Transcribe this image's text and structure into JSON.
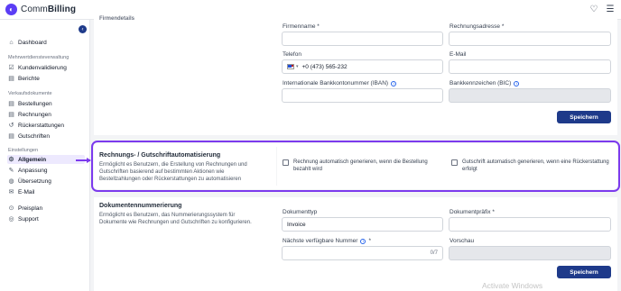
{
  "app": {
    "brand_prefix": "Comm",
    "brand_suffix": "Billing"
  },
  "header": {
    "heart_icon": "heart-icon",
    "menu_icon": "menu-icon"
  },
  "sidebar": {
    "collapse_label": "‹",
    "dashboard": "Dashboard",
    "sec_multi": "Mehrwertdiensteverwaltung",
    "kundenvalidierung": "Kundenvalidierung",
    "berichte": "Berichte",
    "sec_sales": "Verkaufsdokumente",
    "bestellungen": "Bestellungen",
    "rechnungen": "Rechnungen",
    "rueckerstattungen": "Rückerstattungen",
    "gutschriften": "Gutschriften",
    "sec_settings": "Einstellungen",
    "allgemein": "Allgemein",
    "anpassung": "Anpassung",
    "uebersetzung": "Übersetzung",
    "email": "E-Mail",
    "preisplan": "Preisplan",
    "support": "Support"
  },
  "firm": {
    "title": "Firmendetails",
    "firmenname_label": "Firmenname *",
    "rechnungsadresse_label": "Rechnungsadresse *",
    "telefon_label": "Telefon",
    "telefon_value": "+0 (473) 565-232",
    "email_label": "E-Mail",
    "iban_label": "Internationale Bankkontonummer (IBAN)",
    "bic_label": "Bankkennzeichen (BIC)",
    "save": "Speichern"
  },
  "automation": {
    "title": "Rechnungs- / Gutschriftautomatisierung",
    "desc": "Ermöglicht es Benutzern, die Erstellung von Rechnungen und Gutschriften basierend auf bestimmten Aktionen wie Bestellzahlungen oder Rückerstattungen zu automatisieren",
    "cb_invoice": "Rechnung automatisch generieren, wenn die Bestellung bezahlt wird",
    "cb_credit": "Gutschrift automatisch generieren, wenn eine Rückerstattung erfolgt"
  },
  "numbering": {
    "title": "Dokumentennummerierung",
    "desc": "Ermöglicht es Benutzern, das Nummerierungssystem für Dokumente wie Rechnungen und Gutschriften zu konfigurieren.",
    "doctype_label": "Dokumenttyp",
    "doctype_value": "Invoice",
    "prefix_label": "Dokumentpräfix *",
    "next_label": "Nächste verfügbare Nummer",
    "next_required": "*",
    "counter": "0/7",
    "preview_label": "Vorschau",
    "save": "Speichern"
  },
  "watermark": "Activate Windows"
}
